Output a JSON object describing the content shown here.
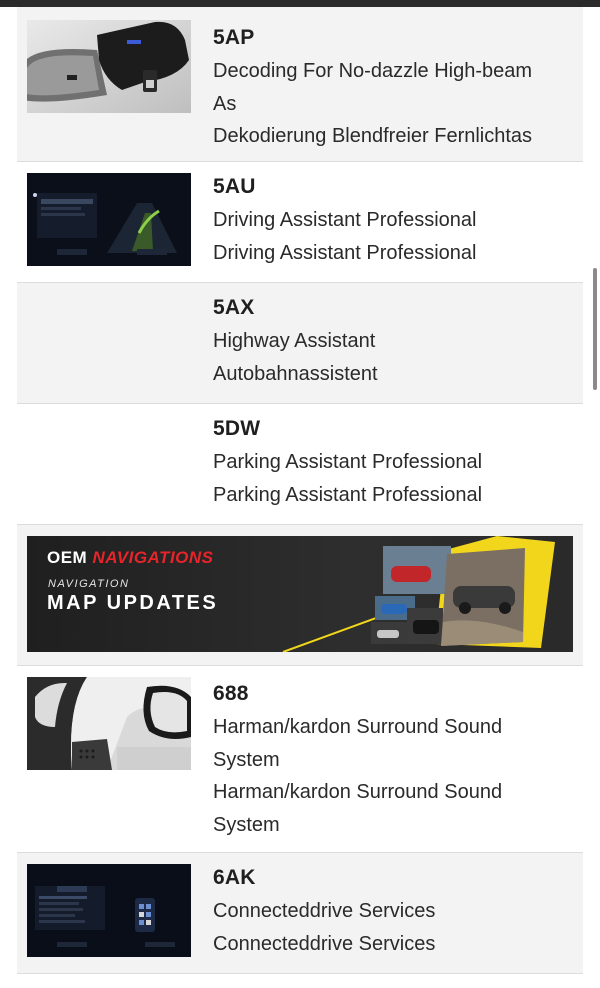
{
  "options": [
    {
      "code": "5AP",
      "lines": [
        "Decoding For No-dazzle High-beam",
        "As",
        "Dekodierung Blendfreier Fernlichtas"
      ],
      "thumbnail": "interior-rear-view-mirror-camera"
    },
    {
      "code": "5AU",
      "lines": [
        "Driving Assistant Professional",
        "Driving Assistant Professional"
      ],
      "thumbnail": "idrive-driving-assistant-screen"
    },
    {
      "code": "5AX",
      "lines": [
        "Highway Assistant",
        "Autobahnassistent"
      ],
      "thumbnail": ""
    },
    {
      "code": "5DW",
      "lines": [
        "Parking Assistant Professional",
        "Parking Assistant Professional"
      ],
      "thumbnail": ""
    }
  ],
  "banner": {
    "brand_part1": "OEM",
    "brand_part2": "NAVIGATIONS",
    "subtitle": "NAVIGATION",
    "title": "MAP UPDATES",
    "accent_color": "#f2d61b",
    "brand_red": "#e8242a"
  },
  "options_after": [
    {
      "code": "688",
      "lines": [
        "Harman/kardon Surround Sound",
        "System",
        "Harman/kardon Surround Sound",
        "System"
      ],
      "thumbnail": "door-mirror-interior-speaker"
    },
    {
      "code": "6AK",
      "lines": [
        "Connecteddrive Services",
        "Connecteddrive Services"
      ],
      "thumbnail": "idrive-connecteddrive-screen"
    }
  ]
}
